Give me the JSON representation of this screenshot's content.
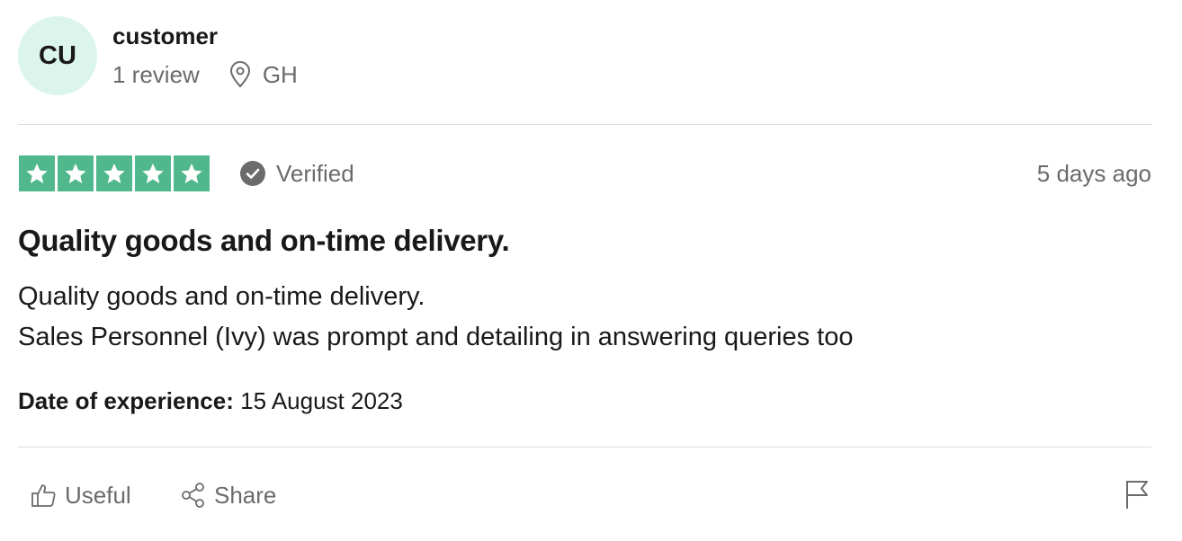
{
  "consumer": {
    "initials": "CU",
    "name": "customer",
    "reviews_count": "1 review",
    "location": "GH",
    "avatar_color": "#dcf5ec"
  },
  "review": {
    "rating": 5,
    "rating_max": 5,
    "star_color": "#51b78c",
    "verified_label": "Verified",
    "date_ago": "5 days ago",
    "title": "Quality goods and on-time delivery.",
    "body_lines": [
      "Quality goods and on-time delivery.",
      "Sales Personnel (Ivy) was prompt and detailing in answering queries too"
    ],
    "experience_label": "Date of experience:",
    "experience_date": "15 August 2023"
  },
  "actions": {
    "useful_label": "Useful",
    "share_label": "Share",
    "useful_icon": "thumbs-up-icon",
    "share_icon": "share-icon",
    "flag_icon": "flag-icon"
  }
}
